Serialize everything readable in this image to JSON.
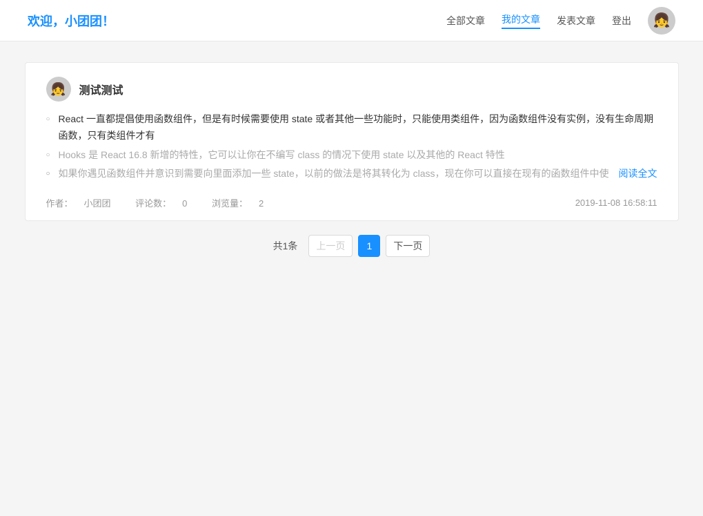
{
  "header": {
    "welcome": "欢迎，小团团！",
    "nav": {
      "all_articles": "全部文章",
      "my_articles": "我的文章",
      "publish_article": "发表文章",
      "logout": "登出"
    },
    "avatar_emoji": "👧"
  },
  "article": {
    "avatar_emoji": "👧",
    "title": "测试测试",
    "content_lines": [
      {
        "text": "React 一直都提倡使用函数组件，但是有时候需要使用 state 或者其他一些功能时，只能使用类组件，因为函数组件没有实例，没有生命周期函数，只有类组件才有",
        "style": "normal"
      },
      {
        "text": "Hooks 是 React 16.8 新增的特性，它可以让你在不编写 class 的情况下使用 state 以及其他的 React 特性",
        "style": "faded"
      },
      {
        "text": "如果你遇见函数组件并意识到需要向里面添加一些 state，以前的做法是将其转化为 class，现在你可以直接在现有的函数组件中使",
        "style": "faded"
      }
    ],
    "read_more_label": "阅读全文",
    "meta": {
      "author_label": "作者：",
      "author": "小团团",
      "comments_label": "评论数：",
      "comments": "0",
      "views_label": "浏览量：",
      "views": "2",
      "datetime": "2019-11-08 16:58:11"
    }
  },
  "pagination": {
    "total_text": "共1条",
    "prev_label": "上一页",
    "next_label": "下一页",
    "current_page": 1,
    "pages": [
      1
    ]
  }
}
